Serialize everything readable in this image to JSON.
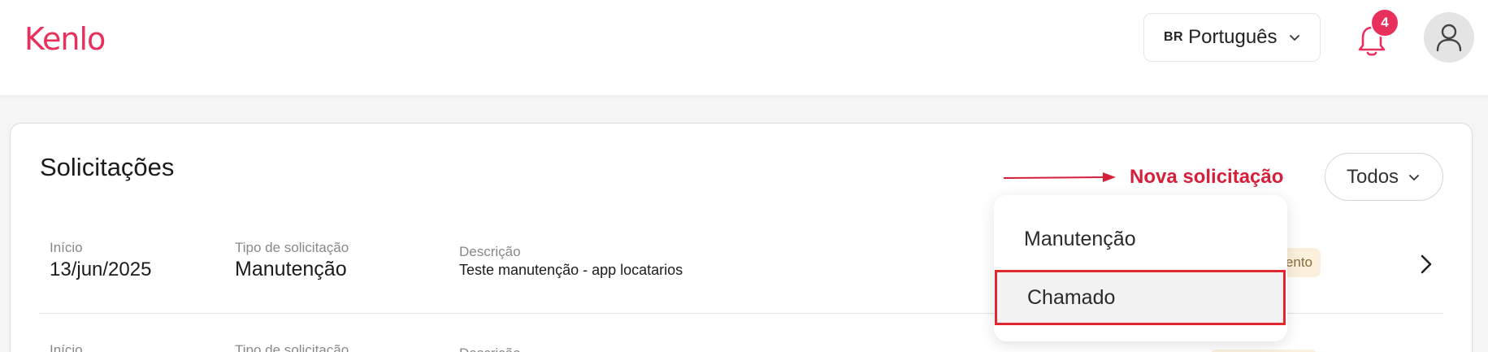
{
  "header": {
    "logo_text": "Kenlo",
    "language": {
      "code": "BR",
      "label": "Português"
    },
    "notifications": {
      "count": "4"
    }
  },
  "colors": {
    "brand": "#e8305d",
    "annotation_red": "#d6203a",
    "status_bg": "#fbf0dc"
  },
  "icons": {
    "language_chevron": "chevron-down-icon",
    "notifications": "bell-icon",
    "user": "user-icon",
    "filter_chevron": "chevron-down-icon",
    "row_open": "chevron-right-icon",
    "annotation": "arrow-right-icon"
  },
  "requests": {
    "title": "Solicitações",
    "new_request_label": "Nova solicitação",
    "filter": {
      "selected": "Todos"
    },
    "columns": {
      "start": "Início",
      "type": "Tipo de solicitação",
      "description": "Descrição"
    },
    "rows": [
      {
        "start": "13/jun/2025",
        "type": "Manutenção",
        "description": "Teste manutenção - app locatarios",
        "status_visible": "ento"
      }
    ]
  },
  "new_request_menu": {
    "items": [
      {
        "label": "Manutenção"
      },
      {
        "label": "Chamado",
        "highlighted": true
      }
    ]
  }
}
